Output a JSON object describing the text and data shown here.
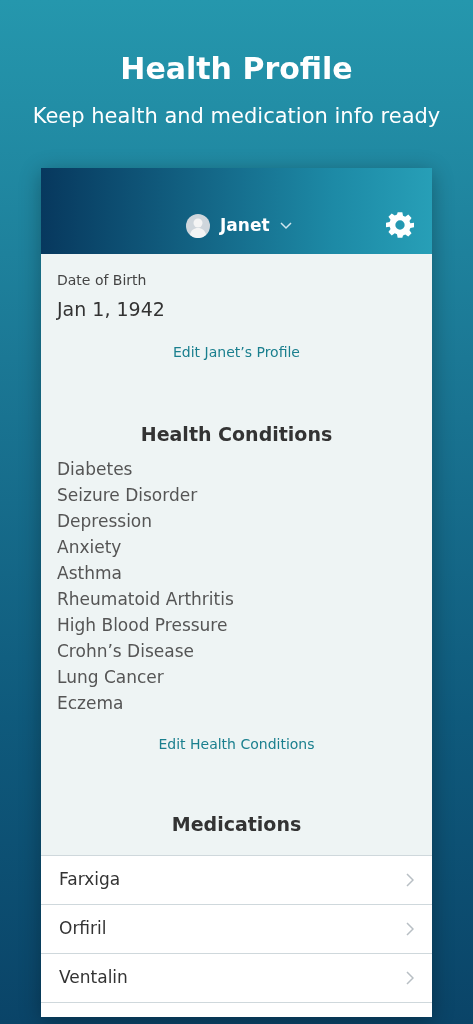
{
  "title": "Health Profile",
  "subtitle": "Keep health and medication info ready",
  "header": {
    "profile_name": "Janet"
  },
  "profile": {
    "dob_label": "Date of Birth",
    "dob": "Jan 1, 1942",
    "edit_link": "Edit Janet’s Profile"
  },
  "conditions": {
    "heading": "Health Conditions",
    "items": [
      "Diabetes",
      "Seizure Disorder",
      "Depression",
      "Anxiety",
      "Asthma",
      "Rheumatoid Arthritis",
      "High Blood Pressure",
      "Crohn’s Disease",
      "Lung Cancer",
      "Eczema"
    ],
    "edit_link": "Edit Health Conditions"
  },
  "medications": {
    "heading": "Medications",
    "items": [
      "Farxiga",
      "Orfiril",
      "Ventalin"
    ]
  }
}
